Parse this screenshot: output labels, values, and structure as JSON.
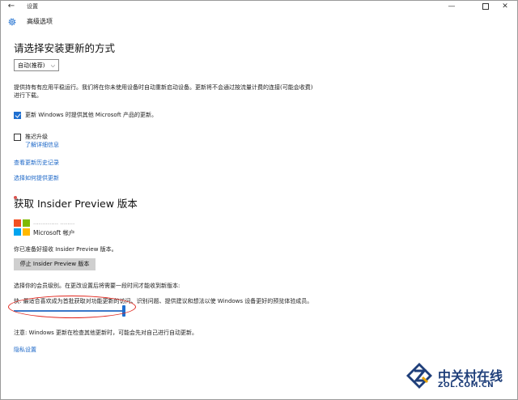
{
  "window": {
    "title": "设置",
    "back_glyph": "←",
    "minimize_glyph": "—",
    "close_glyph": "✕"
  },
  "header": {
    "title": "高级选项"
  },
  "install_updates": {
    "title": "请选择安装更新的方式",
    "dropdown_value": "自动(推荐)",
    "description_line1": "提供持有有应用平稳运行。我们将在你未使用设备时自动重新启动设备。更新将不会通过按流量计费的连接(可能会收费)",
    "description_line2": "进行下载。"
  },
  "options": {
    "ms_updates_label": "更新 Windows 时提供其他 Microsoft 产品的更新。",
    "ms_updates_checked": true,
    "defer_label": "推迟升级",
    "defer_checked": false,
    "learn_more": "了解详细信息"
  },
  "links": {
    "history": "查看更新历史记录",
    "delivery": "选择如何提供更新"
  },
  "insider": {
    "title": "获取 Insider Preview 版本",
    "account_name": "·············· ········",
    "account_type": "Microsoft 帐户",
    "ready_text": "你已准备好接收 Insider Preview 版本。",
    "stop_button": "停止 Insider Preview 版本",
    "level_prompt": "选择你的会员级别。在更改设置后将需要一段时间才能收到新版本:",
    "fast_description": "快: 最适合喜欢成为首批获取对功能更新的访问、识别问题、提供建议和想法以使 Windows 设备更好的预览体验成员。",
    "slider_level_fraction": 1.0
  },
  "footer": {
    "note": "注意: Windows 更新在检查其他更新时，可能会先对自己进行自动更新。",
    "privacy_link": "隐私设置"
  },
  "watermark": {
    "cn": "中关村在线",
    "en": "ZOL.COM.CN"
  },
  "colors": {
    "accent": "#1e6fd0",
    "link": "#1a66c7",
    "annotation": "#e0241b",
    "ms_red": "#f25022",
    "ms_green": "#7fba00",
    "ms_blue": "#00a4ef",
    "ms_yellow": "#ffb900"
  }
}
